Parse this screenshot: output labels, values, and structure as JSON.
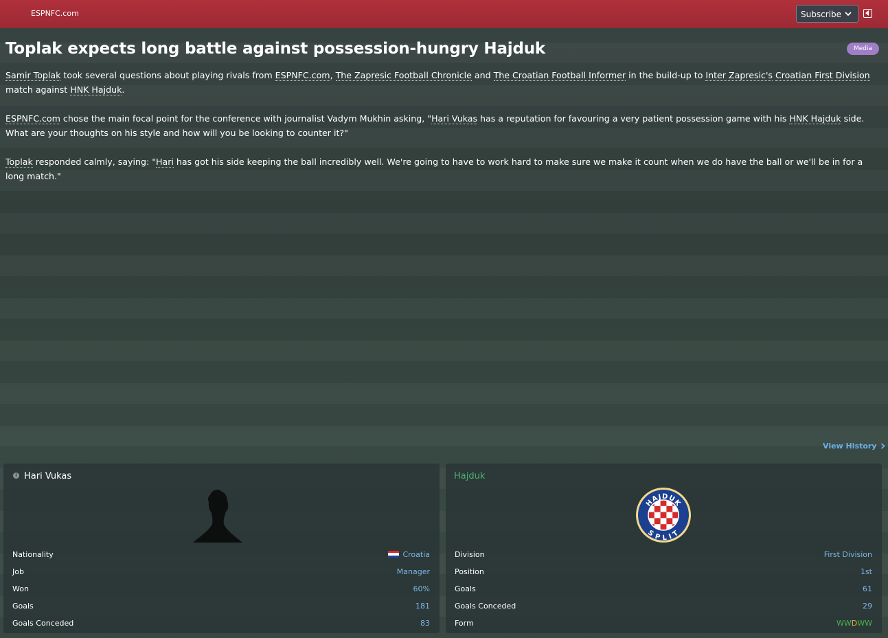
{
  "header": {
    "brand": "ESPNFC.com",
    "subscribe_label": "Subscribe"
  },
  "article": {
    "headline": "Toplak expects long battle against possession-hungry Hajduk",
    "badge": "Media",
    "paragraphs": [
      [
        {
          "t": "Samir Toplak",
          "link": true
        },
        {
          "t": " took several questions about playing rivals from "
        },
        {
          "t": "ESPNFC.com",
          "link": true
        },
        {
          "t": ", "
        },
        {
          "t": "The Zapresic Football Chronicle",
          "link": true
        },
        {
          "t": " and "
        },
        {
          "t": "The Croatian Football Informer",
          "link": true
        },
        {
          "t": " in the build-up to "
        },
        {
          "t": "Inter Zapresic's",
          "link": true
        },
        {
          "t": " "
        },
        {
          "t": "Croatian First Division",
          "link": true
        },
        {
          "t": " match against "
        },
        {
          "t": "HNK Hajduk",
          "link": true
        },
        {
          "t": "."
        }
      ],
      [
        {
          "t": "ESPNFC.com",
          "link": true
        },
        {
          "t": " chose the main focal point for the conference with journalist Vadym Mukhin asking, \""
        },
        {
          "t": "Hari Vukas",
          "link": true
        },
        {
          "t": " has a reputation for favouring a very patient possession game with his "
        },
        {
          "t": "HNK Hajduk",
          "link": true
        },
        {
          "t": " side. What are your thoughts on his style and how will you be looking to counter it?\""
        }
      ],
      [
        {
          "t": "Toplak",
          "link": true
        },
        {
          "t": " responded calmly, saying: \""
        },
        {
          "t": "Hari",
          "link": true
        },
        {
          "t": " has got his side keeping the ball incredibly well. We're going to have to work hard to make sure we make it count when we do have the ball or we'll be in for a long match.\""
        }
      ]
    ],
    "view_history": "View History"
  },
  "manager_panel": {
    "name": "Hari Vukas",
    "stats": [
      {
        "key": "Nationality",
        "value": "Croatia",
        "flag": true
      },
      {
        "key": "Job",
        "value": "Manager"
      },
      {
        "key": "Won",
        "value": "60%"
      },
      {
        "key": "Goals",
        "value": "181"
      },
      {
        "key": "Goals Conceded",
        "value": "83"
      }
    ]
  },
  "club_panel": {
    "name": "Hajduk",
    "crest_text_top": "HAJDUK",
    "crest_text_bottom": "SPLIT",
    "stats": [
      {
        "key": "Division",
        "value": "First Division"
      },
      {
        "key": "Position",
        "value": "1st"
      },
      {
        "key": "Goals",
        "value": "61"
      },
      {
        "key": "Goals Conceded",
        "value": "29"
      },
      {
        "key": "Form",
        "value": "WWDWW",
        "form": [
          "W",
          "W",
          "D",
          "W",
          "W"
        ]
      }
    ]
  },
  "colors": {
    "topbar": "#a32d38",
    "badge": "#a07fc7",
    "link_value": "#7fb4e6",
    "club_name": "#4fae72",
    "win": "#4caf50",
    "draw": "#e3b53a"
  }
}
